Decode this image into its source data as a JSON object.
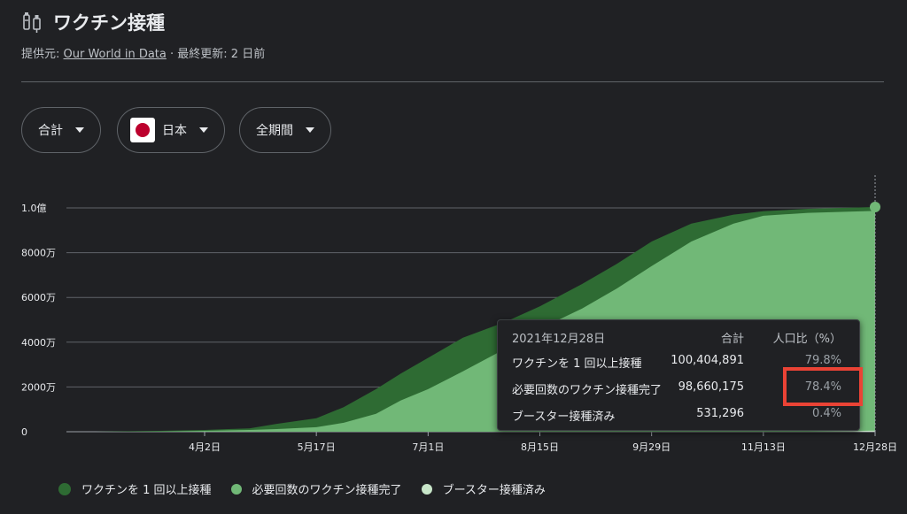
{
  "header": {
    "title": "ワクチン接種",
    "icon": "vaccine-icon",
    "source_prefix": "提供元: ",
    "source_link": "Our World in Data",
    "source_suffix": " · 最終更新: 2 日前"
  },
  "filters": {
    "metric": "合計",
    "country": "日本",
    "period": "全期間"
  },
  "colors": {
    "dose1": "#2e6b33",
    "full": "#71b877",
    "booster": "#c8e6c9",
    "highlight": "#ea4335",
    "background": "#202124"
  },
  "tooltip": {
    "date": "2021年12月28日",
    "col_total": "合計",
    "col_pct": "人口比（%）",
    "rows": [
      {
        "label": "ワクチンを 1 回以上接種",
        "total": "100,404,891",
        "pct": "79.8%"
      },
      {
        "label": "必要回数のワクチン接種完了",
        "total": "98,660,175",
        "pct": "78.4%"
      },
      {
        "label": "ブースター接種済み",
        "total": "531,296",
        "pct": "0.4%"
      }
    ]
  },
  "chart_data": {
    "type": "area",
    "title": "",
    "xlabel": "",
    "ylabel": "",
    "x_ticks": [
      "4月2日",
      "5月17日",
      "7月1日",
      "8月15日",
      "9月29日",
      "11月13日",
      "12月28日"
    ],
    "y_ticks": [
      "0",
      "2000万",
      "4000万",
      "6000万",
      "8000万",
      "1.0億"
    ],
    "ylim": [
      0,
      100000000
    ],
    "x": [
      "2021-02-17",
      "2021-03-15",
      "2021-04-02",
      "2021-04-20",
      "2021-05-01",
      "2021-05-17",
      "2021-05-28",
      "2021-06-10",
      "2021-06-20",
      "2021-07-01",
      "2021-07-15",
      "2021-08-01",
      "2021-08-15",
      "2021-09-01",
      "2021-09-15",
      "2021-09-29",
      "2021-10-15",
      "2021-11-01",
      "2021-11-13",
      "2021-12-01",
      "2021-12-28"
    ],
    "series": [
      {
        "name": "ワクチンを 1 回以上接種",
        "color": "#2e6b33",
        "values": [
          0,
          400000,
          800000,
          1500000,
          3500000,
          6000000,
          11000000,
          19000000,
          26000000,
          33000000,
          42000000,
          49000000,
          56000000,
          66000000,
          75000000,
          85000000,
          93000000,
          97000000,
          98500000,
          99600000,
          100404891
        ]
      },
      {
        "name": "必要回数のワクチン接種完了",
        "color": "#71b877",
        "values": [
          0,
          100000,
          400000,
          800000,
          1200000,
          2000000,
          4000000,
          8000000,
          14000000,
          19000000,
          27000000,
          37000000,
          46000000,
          55000000,
          64000000,
          74000000,
          85000000,
          93000000,
          96500000,
          97800000,
          98660175
        ]
      },
      {
        "name": "ブースター接種済み",
        "color": "#c8e6c9",
        "values": [
          0,
          0,
          0,
          0,
          0,
          0,
          0,
          0,
          0,
          0,
          0,
          0,
          0,
          0,
          0,
          0,
          0,
          0,
          0,
          0,
          531296
        ]
      }
    ],
    "legend_position": "bottom",
    "grid": true
  },
  "legend": [
    {
      "label": "ワクチンを 1 回以上接種",
      "color": "#2e6b33"
    },
    {
      "label": "必要回数のワクチン接種完了",
      "color": "#71b877"
    },
    {
      "label": "ブースター接種済み",
      "color": "#c8e6c9"
    }
  ]
}
